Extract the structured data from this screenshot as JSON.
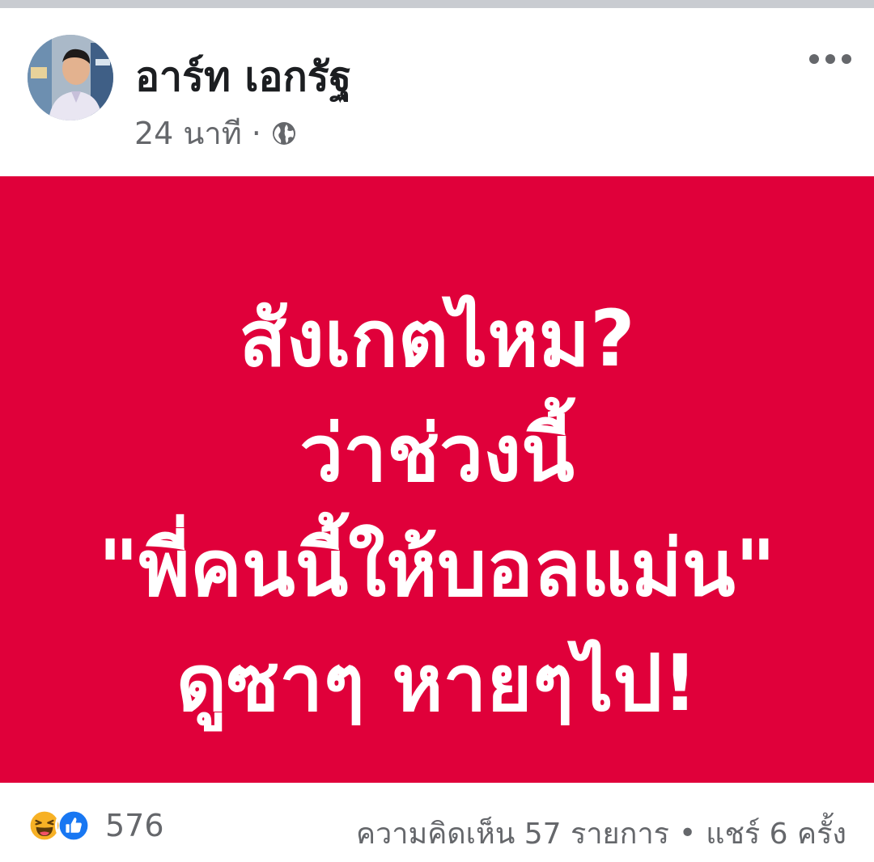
{
  "post": {
    "author_name": "อาร์ท เอกรัฐ",
    "time": "24 นาที",
    "meta_separator": "·",
    "privacy_icon": "globe-icon",
    "more_icon": "more-options-icon"
  },
  "banner": {
    "background_color": "#e0003a",
    "text_color": "#ffffff",
    "lines": [
      "สังเกตไหม?",
      "ว่าช่วงนี้",
      "\"พี่คนนี้ให้บอลแม่น\"",
      "ดูซาๆ หายๆไป!"
    ]
  },
  "footer": {
    "reaction_icons": [
      "haha-reaction-icon",
      "like-reaction-icon"
    ],
    "reaction_count": "576",
    "comments": "ความคิดเห็น 57 รายการ",
    "separator": "•",
    "shares": "แชร์ 6 ครั้ง"
  },
  "colors": {
    "like_blue": "#1877f2",
    "haha_yellow": "#f7b125",
    "secondary_text": "#65676b"
  }
}
